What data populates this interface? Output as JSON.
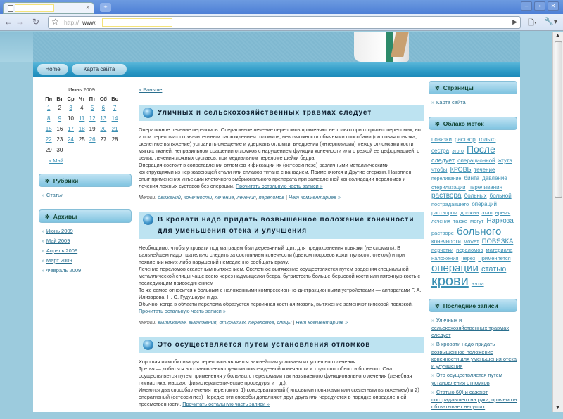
{
  "browser": {
    "url_protocol": "http://",
    "url_host": "www.",
    "close_glyph": "x",
    "new_tab_glyph": "+"
  },
  "nav": {
    "home": "Home",
    "sitemap": "Карта сайта"
  },
  "calendar": {
    "caption": "Июнь 2009",
    "days": [
      "Пн",
      "Вт",
      "Ср",
      "Чт",
      "Пт",
      "Сб",
      "Вс"
    ],
    "weeks": [
      [
        {
          "d": "1",
          "l": true
        },
        {
          "d": "2",
          "l": false
        },
        {
          "d": "3",
          "l": true
        },
        {
          "d": "4",
          "l": false
        },
        {
          "d": "5",
          "l": true
        },
        {
          "d": "6",
          "l": true
        },
        {
          "d": "7",
          "l": true
        }
      ],
      [
        {
          "d": "8",
          "l": true
        },
        {
          "d": "9",
          "l": true
        },
        {
          "d": "10",
          "l": false
        },
        {
          "d": "11",
          "l": true
        },
        {
          "d": "12",
          "l": true
        },
        {
          "d": "13",
          "l": true
        },
        {
          "d": "14",
          "l": true
        }
      ],
      [
        {
          "d": "15",
          "l": true
        },
        {
          "d": "16",
          "l": false
        },
        {
          "d": "17",
          "l": true
        },
        {
          "d": "18",
          "l": true
        },
        {
          "d": "19",
          "l": false
        },
        {
          "d": "20",
          "l": true
        },
        {
          "d": "21",
          "l": true
        }
      ],
      [
        {
          "d": "22",
          "l": true
        },
        {
          "d": "23",
          "l": false
        },
        {
          "d": "24",
          "l": true
        },
        {
          "d": "25",
          "l": false
        },
        {
          "d": "26",
          "l": true
        },
        {
          "d": "27",
          "l": false
        },
        {
          "d": "28",
          "l": false
        }
      ],
      [
        {
          "d": "29",
          "l": false
        },
        {
          "d": "30",
          "l": false
        }
      ]
    ],
    "prev": "« Май"
  },
  "rubrics": {
    "title": "Рубрики",
    "items": [
      "Статьи"
    ]
  },
  "archives": {
    "title": "Архивы",
    "items": [
      "Июнь 2009",
      "Май 2009",
      "Апрель 2009",
      "Март 2009",
      "Февраль 2009"
    ]
  },
  "main": {
    "prev_link": "« Раньше",
    "posts": [
      {
        "title": "Уличных и сельскохозяйственных травмах следует",
        "paragraphs": [
          "Оперативное лечение переломов. Оперативное лечение переломов применяют не только при открытых переломах, но и при переломах со значительным расхождением отломков, невозможности обычными способами (гипсовая повязка, скелетное вытяжение) устранить смещение и удержать отломки, внедрении (интерпозиции) между отломками кости мягких тканей, неправильном сращении отломков с нарушением функции конечности или с резкой ее деформацией; с целью лечения ложных суставов; при медиальном переломе шейки бедра.",
          "Операция состоит в сопоставлении отломков и фиксации их (остеосинтезе) различными металлическими конструкциями из нер-жавеющей стали или сплавов титана с ванадием. Применяются и Другие стержни. Накоплен опыт применения инъекции клеточного эмбрионального препарата при замедленной консолидации переломов и лечения ложных суставов без операции."
        ],
        "more": "Прочитать остальную часть записи »",
        "tags_label": "Метки:",
        "tags": [
          "движений",
          "конечности",
          "лечение",
          "лечения",
          "переломов"
        ],
        "comments": "Нет комментариев »"
      },
      {
        "title": "В кровати надо придать возвышенное положение конечности для уменьшения отека и улучшения",
        "paragraphs": [
          "Необходимо, чтобы у кровати под матрацем был деревянный щит, для предохранения повязки (не сломать). В дальнейшем надо тщательно следить за состоянием конечности (цветом покровов кожи, пульсом, отеком) и при появлении каких-либо нарушений немедленно сообщать врачу.",
          "Лечение переломов скелетным вытяжением. Скелетное вытяжение осуществляется путем введения специальной металлической спицы чаще всего через надмыщелки бедра, бугристость больше-берцовой кости или пяточную кость с последующим присоединением",
          "То же самое относится к больным с наложенными компрессион-но-дистракционными устройствами — аппаратами Г. А. Илизарова, Н. О. Гудушаури и др.",
          "Обычно, когда в области перелома образуется первичная костная мозоль, вытяжение заменяют гипсовой повязкой."
        ],
        "more": "Прочитать остальную часть записи »",
        "tags_label": "Метки:",
        "tags": [
          "вытяжение",
          "вытяжения",
          "открытых",
          "переломов",
          "спицы"
        ],
        "comments": "Нет комментариев »"
      },
      {
        "title": "Это осуществляется путем установления отломков",
        "paragraphs": [
          "Хорошая иммобилизация переломов является важнейшим условием их успешного лечения.",
          "Третья — добиться восстановления функции поврежденной конечности и трудоспособности больного. Она осуществляется путем применения у больных с переломами так называемого функционального лечения (лечебная гимнастика, массаж, физиотерапевтические процедуры и т д.).",
          "Имеются два способа лечения переломов: 1) консервативный (гипсовыми повязками или скелетным вытяжением) и 2) оперативный (остеосинтез) Нередко эти способы дополняют друг друга или чередуются в порядке определенной преемственности."
        ],
        "more": "Прочитать остальную часть записи »"
      }
    ]
  },
  "pages": {
    "title": "Страницы",
    "items": [
      "Карта сайта"
    ]
  },
  "cloud": {
    "title": "Облако меток",
    "tags": [
      {
        "t": "повязки",
        "s": 8
      },
      {
        "t": "раствор",
        "s": 8
      },
      {
        "t": "только",
        "s": 8
      },
      {
        "t": "сестра",
        "s": 8
      },
      {
        "t": "этого",
        "s": 7
      },
      {
        "t": "После",
        "s": 14
      },
      {
        "t": "следует",
        "s": 9
      },
      {
        "t": "операционной",
        "s": 8
      },
      {
        "t": "жгута",
        "s": 8
      },
      {
        "t": "чтобы",
        "s": 8
      },
      {
        "t": "КРОВЬ",
        "s": 9
      },
      {
        "t": "течение",
        "s": 8
      },
      {
        "t": "переливание",
        "s": 7
      },
      {
        "t": "бинта",
        "s": 8
      },
      {
        "t": "давление",
        "s": 8
      },
      {
        "t": "стерилизации",
        "s": 7.5
      },
      {
        "t": "переливания",
        "s": 8
      },
      {
        "t": "раствора",
        "s": 10
      },
      {
        "t": "больных",
        "s": 8
      },
      {
        "t": "больной",
        "s": 8
      },
      {
        "t": "пострадавшего",
        "s": 7.5
      },
      {
        "t": "операций",
        "s": 8
      },
      {
        "t": "раствором",
        "s": 7.5
      },
      {
        "t": "должна",
        "s": 7.5
      },
      {
        "t": "этап",
        "s": 7.5
      },
      {
        "t": "время",
        "s": 7.5
      },
      {
        "t": "лечения",
        "s": 7
      },
      {
        "t": "также",
        "s": 7.5
      },
      {
        "t": "могут",
        "s": 7.5
      },
      {
        "t": "Наркоза",
        "s": 10
      },
      {
        "t": "растворе",
        "s": 7.5
      },
      {
        "t": "больного",
        "s": 15
      },
      {
        "t": "конечности",
        "s": 8
      },
      {
        "t": "может",
        "s": 7.5
      },
      {
        "t": "ПОВЯЗКА",
        "s": 9.5
      },
      {
        "t": "перчатки",
        "s": 7.5
      },
      {
        "t": "переломов",
        "s": 7.5
      },
      {
        "t": "материала",
        "s": 7.5
      },
      {
        "t": "наложения",
        "s": 7.5
      },
      {
        "t": "через",
        "s": 7.5
      },
      {
        "t": "Применяется",
        "s": 7.5
      },
      {
        "t": "операции",
        "s": 15
      },
      {
        "t": "статью",
        "s": 11
      },
      {
        "t": "крови",
        "s": 20
      },
      {
        "t": "азота",
        "s": 7
      }
    ]
  },
  "recent": {
    "title": "Последние записи",
    "items": [
      "Уличных и сельскохозяйственных травмах следует",
      "В кровати надо придать возвышенное положение конечности для уменьшения отека и улучшения",
      "Это осуществляется путем установления отломков",
      "Статью 60) и сажают пострадавшего на руки, причем он обхватывает несущих"
    ]
  }
}
